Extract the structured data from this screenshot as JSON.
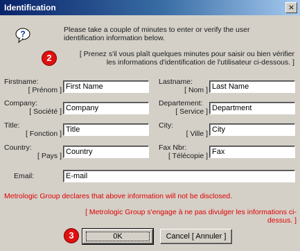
{
  "window": {
    "title": "Identification",
    "close_glyph": "×"
  },
  "intro": {
    "en": "Please take a couple of minutes to enter or verify the user identification information below.",
    "fr": "[ Prenez s'il vous plaît quelques minutes pour saisir ou bien vérifier les informations d'identification de l'utilisateur ci-dessous. ]"
  },
  "badges": {
    "two": "2",
    "three": "3"
  },
  "fields": {
    "firstname": {
      "label_en": "Firstname:",
      "label_fr": "[ Prénom ]",
      "value": "First Name"
    },
    "lastname": {
      "label_en": "Lastname:",
      "label_fr": "[ Nom ]",
      "value": "Last Name"
    },
    "company": {
      "label_en": "Company:",
      "label_fr": "[ Société ]",
      "value": "Company"
    },
    "department": {
      "label_en": "Departement:",
      "label_fr": "[ Service ]",
      "value": "Department"
    },
    "title": {
      "label_en": "Title:",
      "label_fr": "[ Fonction ]",
      "value": "Title"
    },
    "city": {
      "label_en": "City:",
      "label_fr": "[ Ville ]",
      "value": "City"
    },
    "country": {
      "label_en": "Country:",
      "label_fr": "[ Pays ]",
      "value": "Country"
    },
    "fax": {
      "label_en": "Fax Nbr:",
      "label_fr": "[ Télécopie ]",
      "value": "Fax"
    },
    "email": {
      "label": "Email:",
      "value": "E-mail"
    }
  },
  "notice": {
    "en": "Metrologic Group declares that above information will not be disclosed.",
    "fr": "[ Metrologic Group s'engage à ne pas divulger les informations ci-dessus. ]"
  },
  "buttons": {
    "ok": "0K",
    "cancel": "Cancel [ Annuler ]"
  },
  "colors": {
    "title_bar": "#0a246a",
    "badge": "#e01010",
    "notice": "#e00000",
    "dialog_face": "#d4d0c8"
  },
  "icons": {
    "help": "question-icon"
  }
}
